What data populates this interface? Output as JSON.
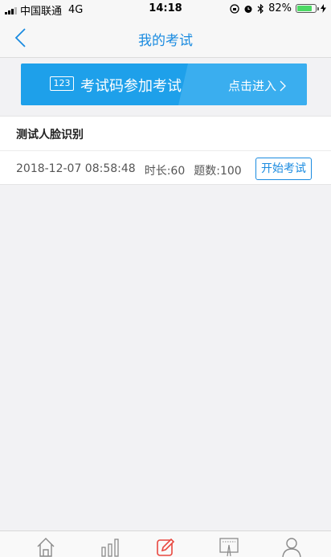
{
  "status_bar": {
    "carrier": "中国联通",
    "network": "4G",
    "time": "14:18",
    "battery": "82%",
    "battery_level": 0.82
  },
  "nav": {
    "title": "我的考试",
    "back_icon": "chevron-left-icon"
  },
  "banner": {
    "icon_text": "123",
    "label": "考试码参加考试",
    "enter_label": "点击进入"
  },
  "exam": {
    "title": "测试人脸识别",
    "datetime": "2018-12-07 08:58:48",
    "duration": "时长:60",
    "question_count": "题数:100",
    "start_label": "开始考试"
  },
  "tabs": [
    {
      "icon": "home-icon"
    },
    {
      "icon": "bar-chart-icon"
    },
    {
      "icon": "edit-icon",
      "active": true
    },
    {
      "icon": "calendar-icon"
    },
    {
      "icon": "user-icon"
    }
  ],
  "colors": {
    "accent": "#1a8be0",
    "banner": "#1ea0ea",
    "active_tab": "#e8473f",
    "battery": "#4cd964"
  }
}
